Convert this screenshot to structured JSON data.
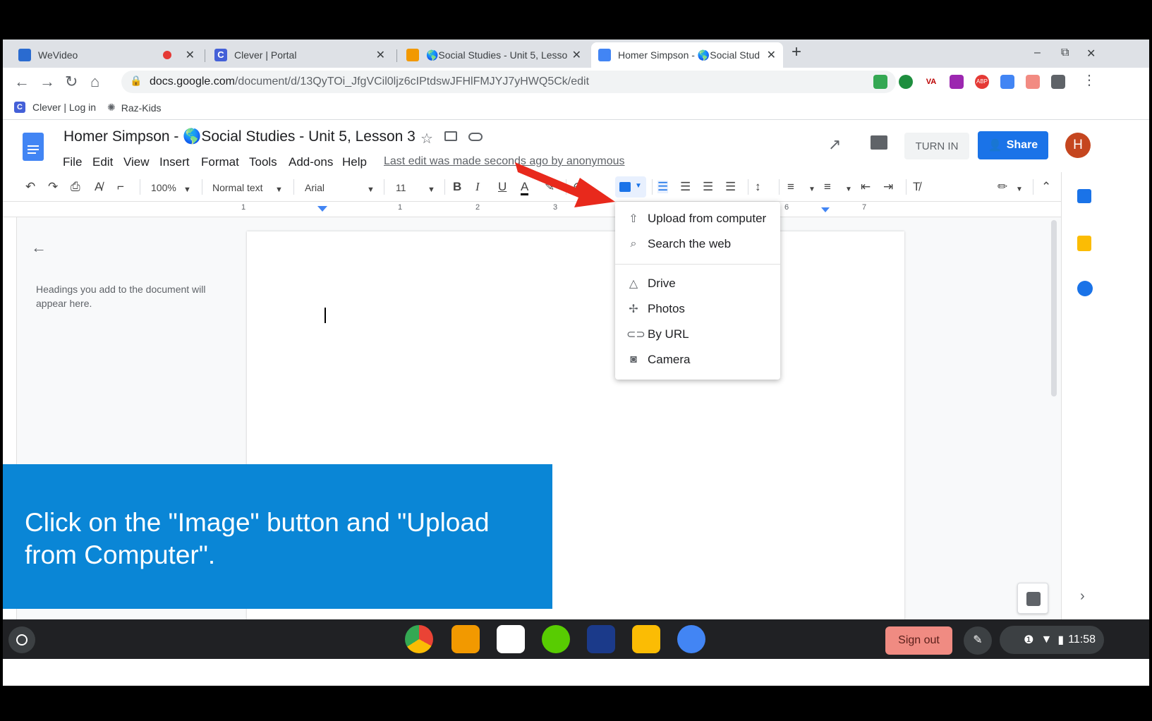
{
  "tabs": [
    {
      "title": "WeVideo",
      "favicon_color": "#2a6bd0",
      "recording": true
    },
    {
      "title": "Clever | Portal",
      "favicon_color": "#4460d8"
    },
    {
      "title": "🌎Social Studies - Unit 5, Lesson",
      "favicon_color": "#f29900"
    },
    {
      "title": "Homer Simpson - 🌎Social Stud",
      "favicon_color": "#4285f4",
      "active": true
    }
  ],
  "new_tab": "+",
  "window_controls": [
    "–",
    "⧉",
    "✕"
  ],
  "address_bar": {
    "url_host": "docs.google.com",
    "url_path": "/document/d/13QyTOi_JfgVCil0ljz6cIPtdswJFHlFMJYJ7yHWQ5Ck/edit"
  },
  "bookmarks": [
    {
      "label": "Clever | Log in",
      "icon": "clever-icon"
    },
    {
      "label": "Raz-Kids",
      "icon": "raz-kids-icon"
    }
  ],
  "doc": {
    "title": "Homer Simpson - 🌎Social Studies - Unit 5, Lesson 3",
    "menus": [
      "File",
      "Edit",
      "View",
      "Insert",
      "Format",
      "Tools",
      "Add-ons",
      "Help"
    ],
    "last_edit": "Last edit was made seconds ago by anonymous",
    "turn_in": "TURN IN",
    "share": "Share",
    "avatar_letter": "H"
  },
  "format_toolbar": {
    "zoom": "100%",
    "style": "Normal text",
    "font": "Arial",
    "size": "11",
    "bold": "B",
    "italic": "I",
    "underline": "U",
    "text_color": "A"
  },
  "ruler_numbers": [
    "1",
    "1",
    "2",
    "3",
    "6",
    "7"
  ],
  "outline": {
    "text": "Headings you add to the document will appear here."
  },
  "image_menu": {
    "items": [
      {
        "label": "Upload from computer",
        "icon": "upload-icon"
      },
      {
        "label": "Search the web",
        "icon": "search-icon"
      },
      {
        "label": "Drive",
        "icon": "drive-icon"
      },
      {
        "label": "Photos",
        "icon": "photos-icon"
      },
      {
        "label": "By URL",
        "icon": "link-icon"
      },
      {
        "label": "Camera",
        "icon": "camera-icon"
      }
    ]
  },
  "caption": "Click on the \"Image\" button and \"Upload from Computer\".",
  "shelf": {
    "sign_out": "Sign out",
    "time": "11:58"
  },
  "colors": {
    "accent": "#1a73e8",
    "caption_bg": "#0a86d6",
    "arrow": "#e8291c"
  }
}
